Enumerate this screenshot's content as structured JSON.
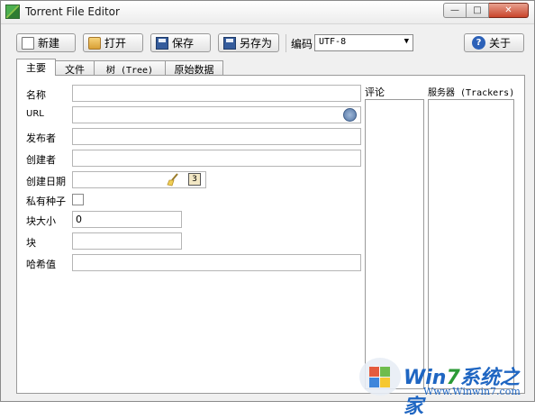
{
  "window": {
    "title": "Torrent File Editor",
    "controls": {
      "minimize": "—",
      "maximize": "□",
      "close": "✕"
    }
  },
  "toolbar": {
    "new_label": "新建",
    "open_label": "打开",
    "save_label": "保存",
    "save_as_label": "另存为",
    "encoding_label": "编码",
    "encoding_value": "UTF-8",
    "about_label": "关于",
    "help_glyph": "?"
  },
  "tabs": [
    {
      "label": "主要",
      "active": true
    },
    {
      "label": "文件",
      "active": false
    },
    {
      "label": "树 (Tree)",
      "active": false
    },
    {
      "label": "原始数据",
      "active": false
    }
  ],
  "form": {
    "name_label": "名称",
    "name_value": "",
    "url_label": "URL",
    "url_value": "",
    "publisher_label": "发布者",
    "publisher_value": "",
    "creator_label": "创建者",
    "creator_value": "",
    "created_date_label": "创建日期",
    "created_date_value": "",
    "private_label": "私有种子",
    "private_checked": false,
    "piece_size_label": "块大小",
    "piece_size_value": "0",
    "pieces_label": "块",
    "pieces_value": "",
    "hash_label": "哈希值",
    "hash_value": "",
    "calendar_glyph": "3"
  },
  "comments": {
    "title": "评论"
  },
  "trackers": {
    "title": "服务器 (Trackers)"
  },
  "watermark": {
    "line1_a": "Win",
    "line1_b": "7",
    "line1_c": "系统之家",
    "line2": "Www.Winwin7.com"
  }
}
